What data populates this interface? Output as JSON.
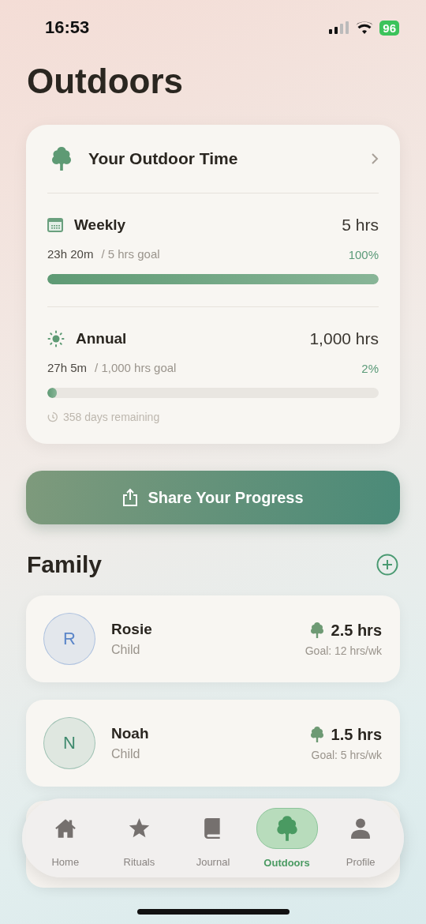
{
  "status_bar": {
    "time": "16:53",
    "battery": "96"
  },
  "title": "Outdoors",
  "summary": {
    "title": "Your Outdoor Time",
    "goals": [
      {
        "kind": "weekly",
        "label": "Weekly",
        "target": "5 hrs",
        "done": "23h 20m",
        "goal": "/ 5 hrs goal",
        "percent": "100%",
        "level": 1.0
      },
      {
        "kind": "annual",
        "label": "Annual",
        "target": "1,000 hrs",
        "done": "27h 5m",
        "goal": "/ 1,000 hrs goal",
        "percent": "2%",
        "level": 0.027,
        "note": "358 days remaining"
      }
    ]
  },
  "share_button": "Share Your Progress",
  "family": {
    "title": "Family",
    "members": [
      {
        "initial": "R",
        "name": "Rosie",
        "role": "Child",
        "hours": "2.5 hrs",
        "goal": "Goal: 12 hrs/wk",
        "color": "#5b86c9"
      },
      {
        "initial": "N",
        "name": "Noah",
        "role": "Child",
        "hours": "1.5 hrs",
        "goal": "Goal: 5 hrs/wk",
        "color": "#3f8a6e"
      }
    ]
  },
  "tabs": [
    {
      "kind": "home",
      "label": "Home",
      "selected": false
    },
    {
      "kind": "star",
      "label": "Rituals",
      "selected": false
    },
    {
      "kind": "book",
      "label": "Journal",
      "selected": false
    },
    {
      "kind": "tree",
      "label": "Outdoors",
      "selected": true
    },
    {
      "kind": "person",
      "label": "Profile",
      "selected": false
    }
  ]
}
